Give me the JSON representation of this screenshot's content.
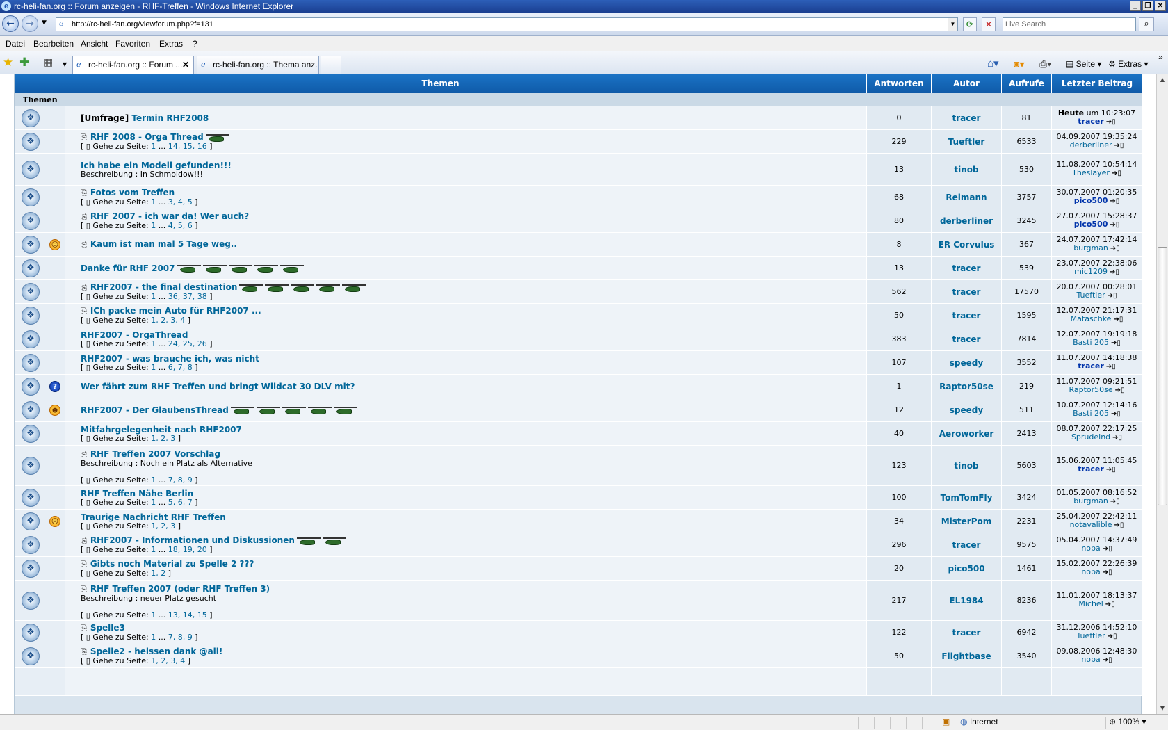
{
  "window": {
    "title": "rc-heli-fan.org :: Forum anzeigen - RHF-Treffen - Windows Internet Explorer"
  },
  "address": {
    "url": "http://rc-heli-fan.org/viewforum.php?f=131",
    "search_placeholder": "Live Search"
  },
  "menu": [
    "Datei",
    "Bearbeiten",
    "Ansicht",
    "Favoriten",
    "Extras",
    "?"
  ],
  "tabs": [
    {
      "label": "rc-heli-fan.org :: Forum ...",
      "active": true
    },
    {
      "label": "rc-heli-fan.org :: Thema anz...",
      "active": false
    }
  ],
  "toolbar": {
    "page": "Seite",
    "tools": "Extras"
  },
  "status": {
    "zone": "Internet",
    "zoom": "100%"
  },
  "table": {
    "headers": {
      "topics": "Themen",
      "replies": "Antworten",
      "author": "Autor",
      "views": "Aufrufe",
      "last": "Letzter Beitrag"
    },
    "section": "Themen",
    "pages_prefix": "Gehe zu Seite:",
    "rows": [
      {
        "prefix": "[Umfrage]",
        "title": "Termin RHF2008",
        "clip": false,
        "emo": "",
        "helis": 0,
        "desc": "",
        "pages": [],
        "replies": "0",
        "author": "tracer",
        "views": "81",
        "last_date_bold": "Heute",
        "last_date": "um 10:23:07",
        "last_user": "tracer",
        "last_user_bold": true
      },
      {
        "prefix": "",
        "title": "RHF 2008 - Orga Thread",
        "clip": true,
        "emo": "",
        "helis": 1,
        "desc": "",
        "pages": [
          "1",
          "...",
          "14,",
          "15,",
          "16"
        ],
        "replies": "229",
        "author": "Tueftler",
        "views": "6533",
        "last_date_bold": "",
        "last_date": "04.09.2007 19:35:24",
        "last_user": "derberliner",
        "last_user_bold": false
      },
      {
        "prefix": "",
        "title": "Ich habe ein Modell gefunden!!!",
        "clip": false,
        "emo": "",
        "helis": 0,
        "desc": "Beschreibung : In Schmoldow!!!",
        "pages": [],
        "replies": "13",
        "author": "tinob",
        "views": "530",
        "last_date_bold": "",
        "last_date": "11.08.2007 10:54:14",
        "last_user": "Theslayer",
        "last_user_bold": false
      },
      {
        "prefix": "",
        "title": "Fotos vom Treffen",
        "clip": true,
        "emo": "",
        "helis": 0,
        "desc": "",
        "pages": [
          "1",
          "...",
          "3,",
          "4,",
          "5"
        ],
        "replies": "68",
        "author": "Reimann",
        "views": "3757",
        "last_date_bold": "",
        "last_date": "30.07.2007 01:20:35",
        "last_user": "pico500",
        "last_user_bold": true
      },
      {
        "prefix": "",
        "title": "RHF 2007 - ich war da! Wer auch?",
        "clip": true,
        "emo": "",
        "helis": 0,
        "desc": "",
        "pages": [
          "1",
          "...",
          "4,",
          "5,",
          "6"
        ],
        "replies": "80",
        "author": "derberliner",
        "views": "3245",
        "last_date_bold": "",
        "last_date": "27.07.2007 15:28:37",
        "last_user": "pico500",
        "last_user_bold": true
      },
      {
        "prefix": "",
        "title": "Kaum ist man mal 5 Tage weg..",
        "clip": true,
        "emo": "smile",
        "helis": 0,
        "desc": "",
        "pages": [],
        "replies": "8",
        "author": "ER Corvulus",
        "views": "367",
        "last_date_bold": "",
        "last_date": "24.07.2007 17:42:14",
        "last_user": "burgman",
        "last_user_bold": false
      },
      {
        "prefix": "",
        "title": "Danke für RHF 2007",
        "clip": false,
        "emo": "",
        "helis": 5,
        "desc": "",
        "pages": [],
        "replies": "13",
        "author": "tracer",
        "views": "539",
        "last_date_bold": "",
        "last_date": "23.07.2007 22:38:06",
        "last_user": "mic1209",
        "last_user_bold": false
      },
      {
        "prefix": "",
        "title": "RHF2007 - the final destination",
        "clip": true,
        "emo": "",
        "helis": 5,
        "desc": "",
        "pages": [
          "1",
          "...",
          "36,",
          "37,",
          "38"
        ],
        "replies": "562",
        "author": "tracer",
        "views": "17570",
        "last_date_bold": "",
        "last_date": "20.07.2007 00:28:01",
        "last_user": "Tueftler",
        "last_user_bold": false
      },
      {
        "prefix": "",
        "title": "ICh packe mein Auto für RHF2007 ...",
        "clip": true,
        "emo": "",
        "helis": 0,
        "desc": "",
        "pages": [
          "1,",
          "2,",
          "3,",
          "4"
        ],
        "replies": "50",
        "author": "tracer",
        "views": "1595",
        "last_date_bold": "",
        "last_date": "12.07.2007 21:17:31",
        "last_user": "Mataschke",
        "last_user_bold": false
      },
      {
        "prefix": "",
        "title": "RHF2007 - OrgaThread",
        "clip": false,
        "emo": "",
        "helis": 0,
        "desc": "",
        "pages": [
          "1",
          "...",
          "24,",
          "25,",
          "26"
        ],
        "replies": "383",
        "author": "tracer",
        "views": "7814",
        "last_date_bold": "",
        "last_date": "12.07.2007 19:19:18",
        "last_user": "Basti 205",
        "last_user_bold": false
      },
      {
        "prefix": "",
        "title": "RHF2007 - was brauche ich, was nicht",
        "clip": false,
        "emo": "",
        "helis": 0,
        "desc": "",
        "pages": [
          "1",
          "...",
          "6,",
          "7,",
          "8"
        ],
        "replies": "107",
        "author": "speedy",
        "views": "3552",
        "last_date_bold": "",
        "last_date": "11.07.2007 14:18:38",
        "last_user": "tracer",
        "last_user_bold": true
      },
      {
        "prefix": "",
        "title": "Wer fährt zum RHF Treffen und bringt Wildcat 30 DLV mit?",
        "clip": false,
        "emo": "q",
        "helis": 0,
        "desc": "",
        "pages": [],
        "replies": "1",
        "author": "Raptor50se",
        "views": "219",
        "last_date_bold": "",
        "last_date": "11.07.2007 09:21:51",
        "last_user": "Raptor50se",
        "last_user_bold": false
      },
      {
        "prefix": "",
        "title": "RHF2007 - Der GlaubensThread",
        "clip": false,
        "emo": "grin",
        "helis": 5,
        "desc": "",
        "pages": [],
        "replies": "12",
        "author": "speedy",
        "views": "511",
        "last_date_bold": "",
        "last_date": "10.07.2007 12:14:16",
        "last_user": "Basti 205",
        "last_user_bold": false
      },
      {
        "prefix": "",
        "title": "Mitfahrgelegenheit nach RHF2007",
        "clip": false,
        "emo": "",
        "helis": 0,
        "desc": "",
        "pages": [
          "1,",
          "2,",
          "3"
        ],
        "replies": "40",
        "author": "Aeroworker",
        "views": "2413",
        "last_date_bold": "",
        "last_date": "08.07.2007 22:17:25",
        "last_user": "Sprudelnd",
        "last_user_bold": false
      },
      {
        "prefix": "",
        "title": "RHF Treffen 2007 Vorschlag",
        "clip": true,
        "emo": "",
        "helis": 0,
        "desc": "Beschreibung : Noch ein Platz als Alternative",
        "pages": [
          "1",
          "...",
          "7,",
          "8,",
          "9"
        ],
        "replies": "123",
        "author": "tinob",
        "views": "5603",
        "last_date_bold": "",
        "last_date": "15.06.2007 11:05:45",
        "last_user": "tracer",
        "last_user_bold": true
      },
      {
        "prefix": "",
        "title": "RHF Treffen Nähe Berlin",
        "clip": false,
        "emo": "",
        "helis": 0,
        "desc": "",
        "pages": [
          "1",
          "...",
          "5,",
          "6,",
          "7"
        ],
        "replies": "100",
        "author": "TomTomFly",
        "views": "3424",
        "last_date_bold": "",
        "last_date": "01.05.2007 08:16:52",
        "last_user": "burgman",
        "last_user_bold": false
      },
      {
        "prefix": "",
        "title": "Traurige Nachricht RHF Treffen",
        "clip": false,
        "emo": "sad",
        "helis": 0,
        "desc": "",
        "pages": [
          "1,",
          "2,",
          "3"
        ],
        "replies": "34",
        "author": "MisterPom",
        "views": "2231",
        "last_date_bold": "",
        "last_date": "25.04.2007 22:42:11",
        "last_user": "notavalible",
        "last_user_bold": false
      },
      {
        "prefix": "",
        "title": "RHF2007 - Informationen und Diskussionen",
        "clip": true,
        "emo": "",
        "helis": 2,
        "desc": "",
        "pages": [
          "1",
          "...",
          "18,",
          "19,",
          "20"
        ],
        "replies": "296",
        "author": "tracer",
        "views": "9575",
        "last_date_bold": "",
        "last_date": "05.04.2007 14:37:49",
        "last_user": "nopa",
        "last_user_bold": false
      },
      {
        "prefix": "",
        "title": "Gibts noch Material zu Spelle 2 ???",
        "clip": true,
        "emo": "",
        "helis": 0,
        "desc": "",
        "pages": [
          "1,",
          "2"
        ],
        "replies": "20",
        "author": "pico500",
        "views": "1461",
        "last_date_bold": "",
        "last_date": "15.02.2007 22:26:39",
        "last_user": "nopa",
        "last_user_bold": false
      },
      {
        "prefix": "",
        "title": "RHF Treffen 2007 (oder RHF Treffen 3)",
        "clip": true,
        "emo": "",
        "helis": 0,
        "desc": "Beschreibung : neuer Platz gesucht",
        "pages": [
          "1",
          "...",
          "13,",
          "14,",
          "15"
        ],
        "replies": "217",
        "author": "EL1984",
        "views": "8236",
        "last_date_bold": "",
        "last_date": "11.01.2007 18:13:37",
        "last_user": "Michel",
        "last_user_bold": false
      },
      {
        "prefix": "",
        "title": "Spelle3",
        "clip": true,
        "emo": "",
        "helis": 0,
        "desc": "",
        "pages": [
          "1",
          "...",
          "7,",
          "8,",
          "9"
        ],
        "replies": "122",
        "author": "tracer",
        "views": "6942",
        "last_date_bold": "",
        "last_date": "31.12.2006 14:52:10",
        "last_user": "Tueftler",
        "last_user_bold": false
      },
      {
        "prefix": "",
        "title": "Spelle2 - heissen dank @all!",
        "clip": true,
        "emo": "",
        "helis": 0,
        "desc": "",
        "pages": [
          "1,",
          "2,",
          "3,",
          "4"
        ],
        "replies": "50",
        "author": "Flightbase",
        "views": "3540",
        "last_date_bold": "",
        "last_date": "09.08.2006 12:48:30",
        "last_user": "nopa",
        "last_user_bold": false
      }
    ]
  }
}
